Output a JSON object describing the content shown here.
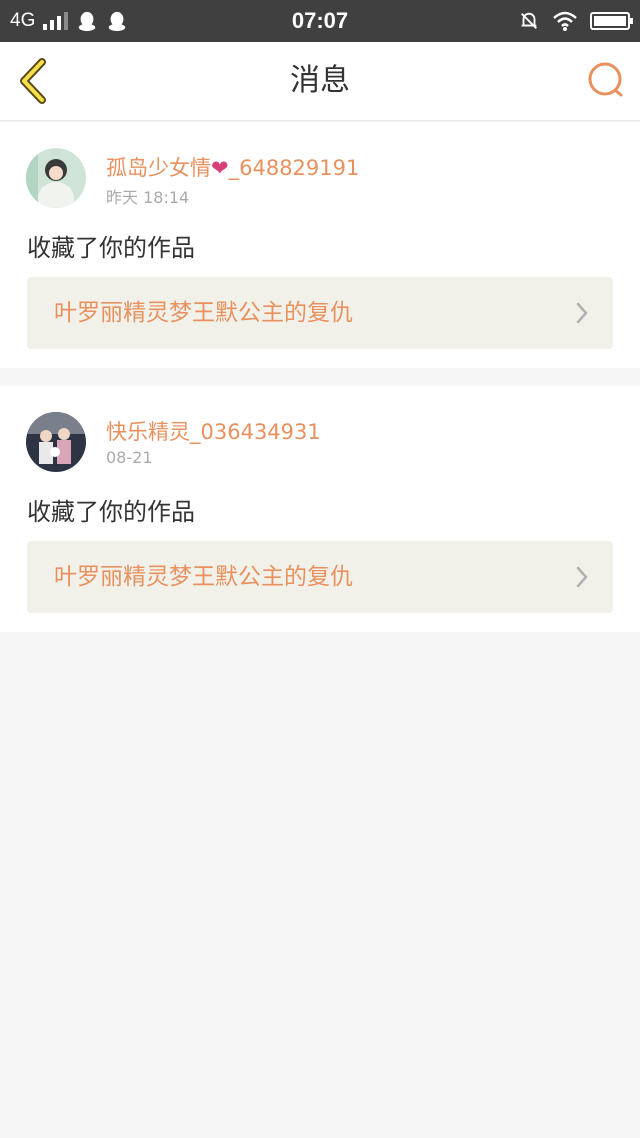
{
  "status_bar": {
    "network": "4G",
    "time": "07:07",
    "icons": [
      "signal-icon",
      "qq-icon",
      "qq-icon",
      "silent-bell-icon",
      "wifi-icon",
      "battery-icon"
    ],
    "battery_level": 1.0
  },
  "header": {
    "title": "消息",
    "back_icon": "chevron-left-icon",
    "search_icon": "search-icon",
    "accent_color": "#e8915e"
  },
  "messages": [
    {
      "username_prefix": "孤岛少女情",
      "username_suffix": "_648829191",
      "time": "昨天 18:14",
      "action": "收藏了你的作品",
      "work_title": "叶罗丽精灵梦王默公主的复仇"
    },
    {
      "username": "快乐精灵_036434931",
      "time": "08-21",
      "action": "收藏了你的作品",
      "work_title": "叶罗丽精灵梦王默公主的复仇"
    }
  ]
}
